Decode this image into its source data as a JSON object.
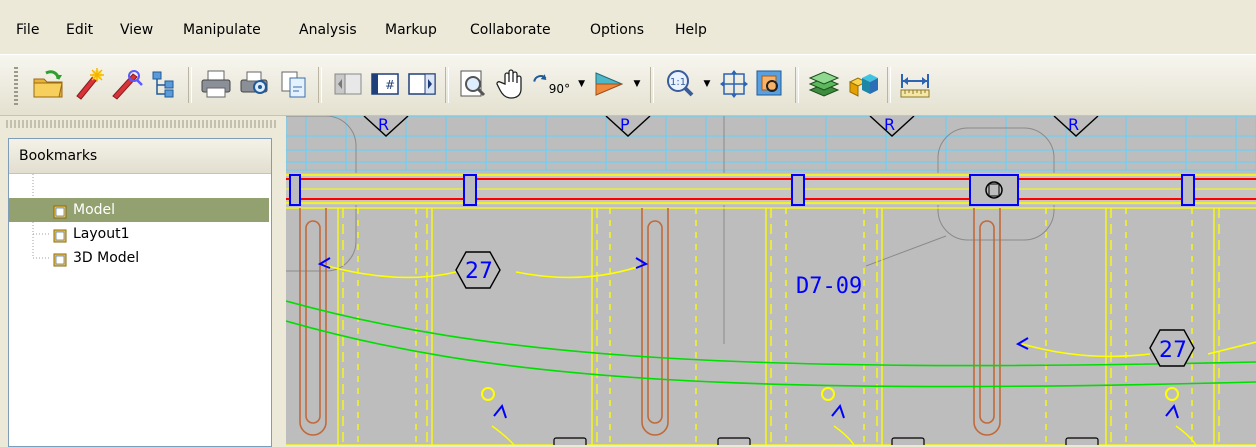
{
  "menu": {
    "file": "File",
    "edit": "Edit",
    "view": "View",
    "manipulate": "Manipulate",
    "analysis": "Analysis",
    "markup": "Markup",
    "collaborate": "Collaborate",
    "options": "Options",
    "help": "Help"
  },
  "toolbar": {
    "zoom_rotate_label": "90°",
    "zoom_actual_label": "1:1",
    "icons": [
      "open-folder-icon",
      "markup-pen-icon",
      "measure-pen-icon",
      "hierarchy-icon",
      "print-icon",
      "print-preview-icon",
      "publish-icon",
      "previous-page-icon",
      "page-grid-icon",
      "next-page-icon",
      "fit-page-icon",
      "pan-hand-icon",
      "rotate-icon",
      "shading-icon",
      "zoom-actual-icon",
      "fit-window-icon",
      "zoom-window-icon",
      "layers-icon",
      "model-3d-icon",
      "measure-distance-icon"
    ]
  },
  "bookmarks": {
    "title": "Bookmarks",
    "items": [
      {
        "label": "Model",
        "selected": true
      },
      {
        "label": "Layout1",
        "selected": false
      },
      {
        "label": "3D Model",
        "selected": false
      }
    ]
  },
  "drawing": {
    "text_label": "D7-09",
    "hex_tags": [
      "27",
      "27"
    ],
    "diamond_tags": [
      "R",
      "P",
      "R",
      "R"
    ],
    "colors": {
      "background": "#bdbdbd",
      "yellow": "#ffff00",
      "green": "#00dd00",
      "red": "#ff0000",
      "blue": "#0000ff",
      "orange": "#c06a3a",
      "cyan": "#5fd2ff"
    }
  }
}
